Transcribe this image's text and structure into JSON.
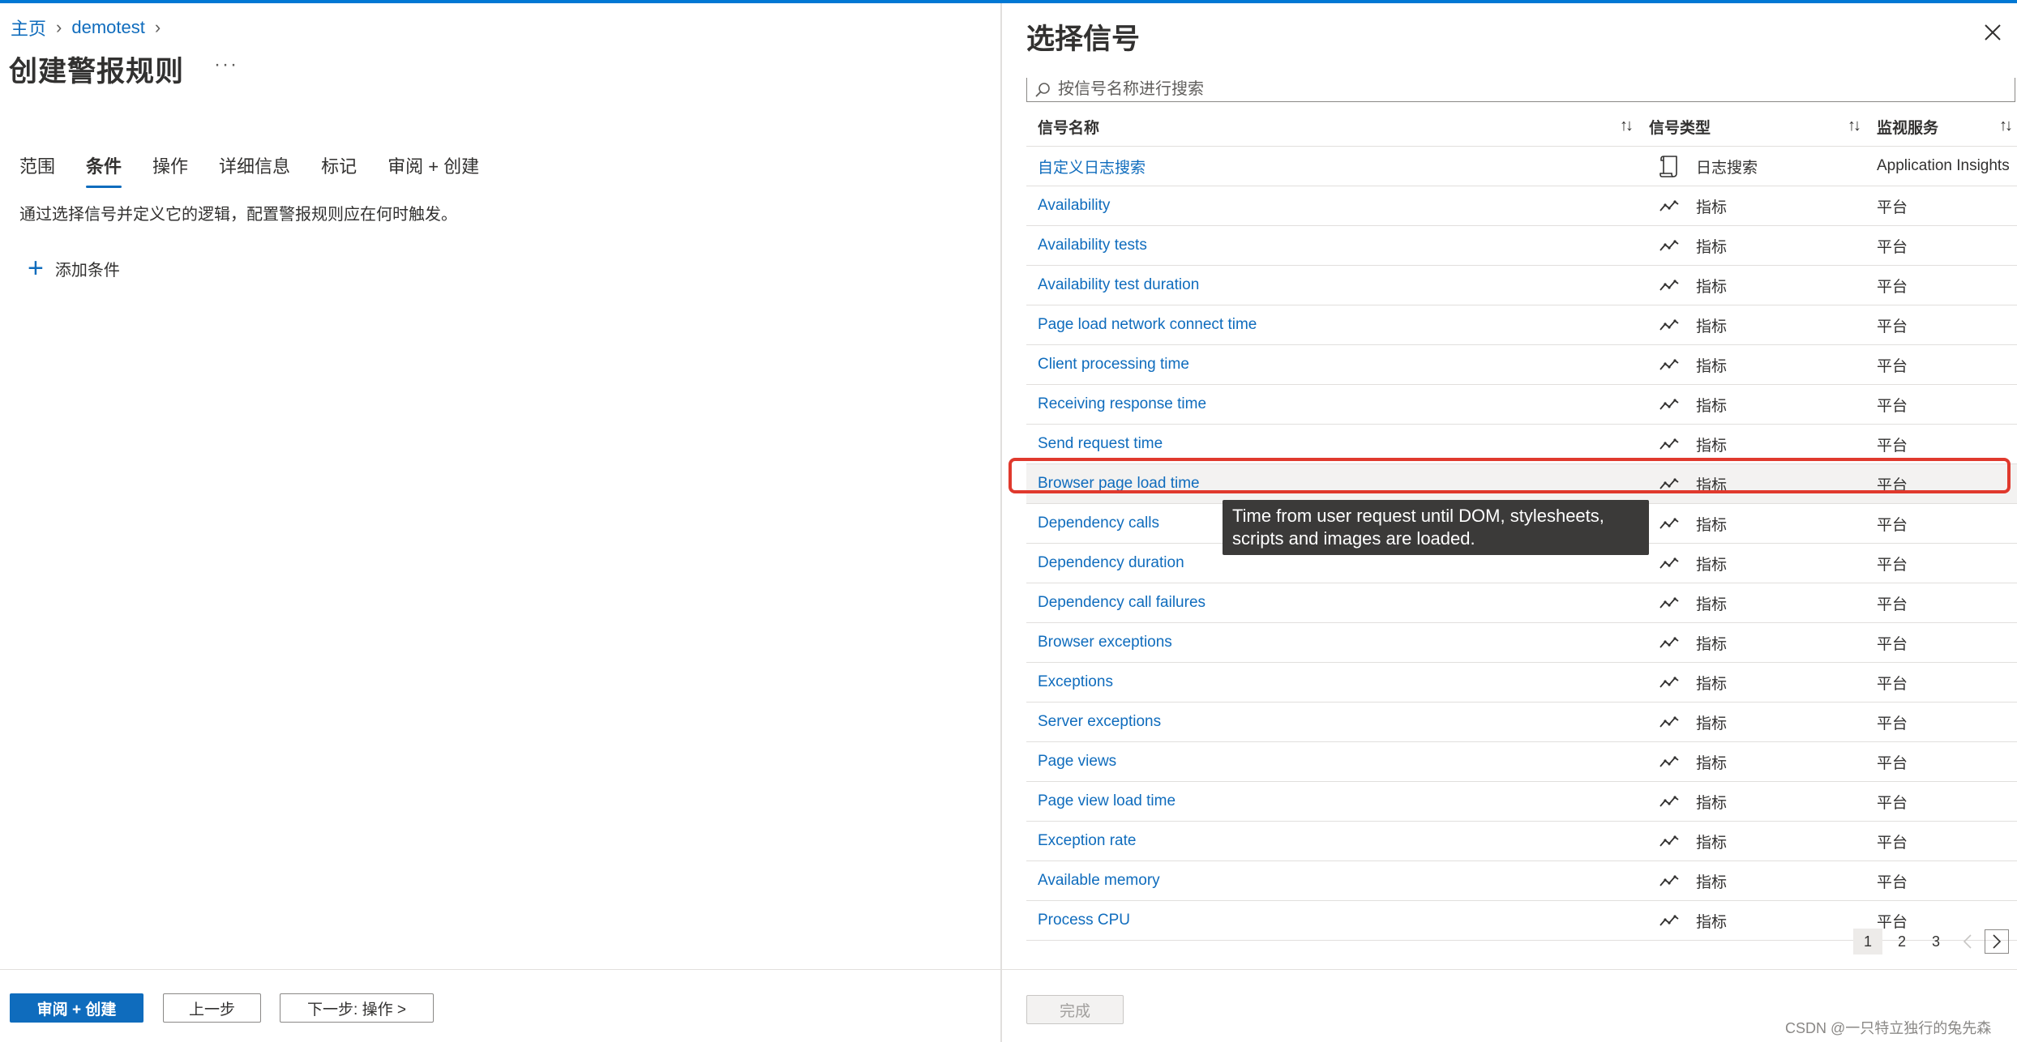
{
  "breadcrumb": [
    {
      "label": "主页"
    },
    {
      "label": "demotest"
    }
  ],
  "page_title": "创建警报规则",
  "more_label": "···",
  "tabs": [
    {
      "label": "范围"
    },
    {
      "label": "条件"
    },
    {
      "label": "操作"
    },
    {
      "label": "详细信息"
    },
    {
      "label": "标记"
    },
    {
      "label": "审阅 + 创建"
    }
  ],
  "active_tab": "条件",
  "description": "通过选择信号并定义它的逻辑，配置警报规则应在何时触发。",
  "add_condition_label": "添加条件",
  "footer": {
    "review_create": "审阅 + 创建",
    "prev": "上一步",
    "next": "下一步: 操作 >"
  },
  "panel": {
    "title": "选择信号",
    "search_placeholder": "按信号名称进行搜索",
    "columns": {
      "name": "信号名称",
      "type": "信号类型",
      "service": "监视服务"
    },
    "sort_symbol": "↑↓",
    "rows": [
      {
        "name": "自定义日志搜索",
        "type": "日志搜索",
        "type_icon": "log-search-icon",
        "service": "Application Insights"
      },
      {
        "name": "Availability",
        "type": "指标",
        "type_icon": "metric-icon",
        "service": "平台"
      },
      {
        "name": "Availability tests",
        "type": "指标",
        "type_icon": "metric-icon",
        "service": "平台"
      },
      {
        "name": "Availability test duration",
        "type": "指标",
        "type_icon": "metric-icon",
        "service": "平台"
      },
      {
        "name": "Page load network connect time",
        "type": "指标",
        "type_icon": "metric-icon",
        "service": "平台"
      },
      {
        "name": "Client processing time",
        "type": "指标",
        "type_icon": "metric-icon",
        "service": "平台"
      },
      {
        "name": "Receiving response time",
        "type": "指标",
        "type_icon": "metric-icon",
        "service": "平台"
      },
      {
        "name": "Send request time",
        "type": "指标",
        "type_icon": "metric-icon",
        "service": "平台"
      },
      {
        "name": "Browser page load time",
        "type": "指标",
        "type_icon": "metric-icon",
        "service": "平台"
      },
      {
        "name": "Dependency calls",
        "type": "指标",
        "type_icon": "metric-icon",
        "service": "平台"
      },
      {
        "name": "Dependency duration",
        "type": "指标",
        "type_icon": "metric-icon",
        "service": "平台"
      },
      {
        "name": "Dependency call failures",
        "type": "指标",
        "type_icon": "metric-icon",
        "service": "平台"
      },
      {
        "name": "Browser exceptions",
        "type": "指标",
        "type_icon": "metric-icon",
        "service": "平台"
      },
      {
        "name": "Exceptions",
        "type": "指标",
        "type_icon": "metric-icon",
        "service": "平台"
      },
      {
        "name": "Server exceptions",
        "type": "指标",
        "type_icon": "metric-icon",
        "service": "平台"
      },
      {
        "name": "Page views",
        "type": "指标",
        "type_icon": "metric-icon",
        "service": "平台"
      },
      {
        "name": "Page view load time",
        "type": "指标",
        "type_icon": "metric-icon",
        "service": "平台"
      },
      {
        "name": "Exception rate",
        "type": "指标",
        "type_icon": "metric-icon",
        "service": "平台"
      },
      {
        "name": "Available memory",
        "type": "指标",
        "type_icon": "metric-icon",
        "service": "平台"
      },
      {
        "name": "Process CPU",
        "type": "指标",
        "type_icon": "metric-icon",
        "service": "平台"
      }
    ],
    "highlighted_row": "Browser page load time",
    "tooltip": "Time from user request until DOM, stylesheets, scripts and images are loaded.",
    "pagination": {
      "pages": [
        "1",
        "2",
        "3"
      ],
      "current": "1"
    },
    "done_label": "完成"
  },
  "colors": {
    "accent": "#0f6cbd",
    "highlight_border": "#e0392d",
    "tooltip_bg": "#3b3a39"
  },
  "watermark": "CSDN @一只特立独行的兔先森"
}
